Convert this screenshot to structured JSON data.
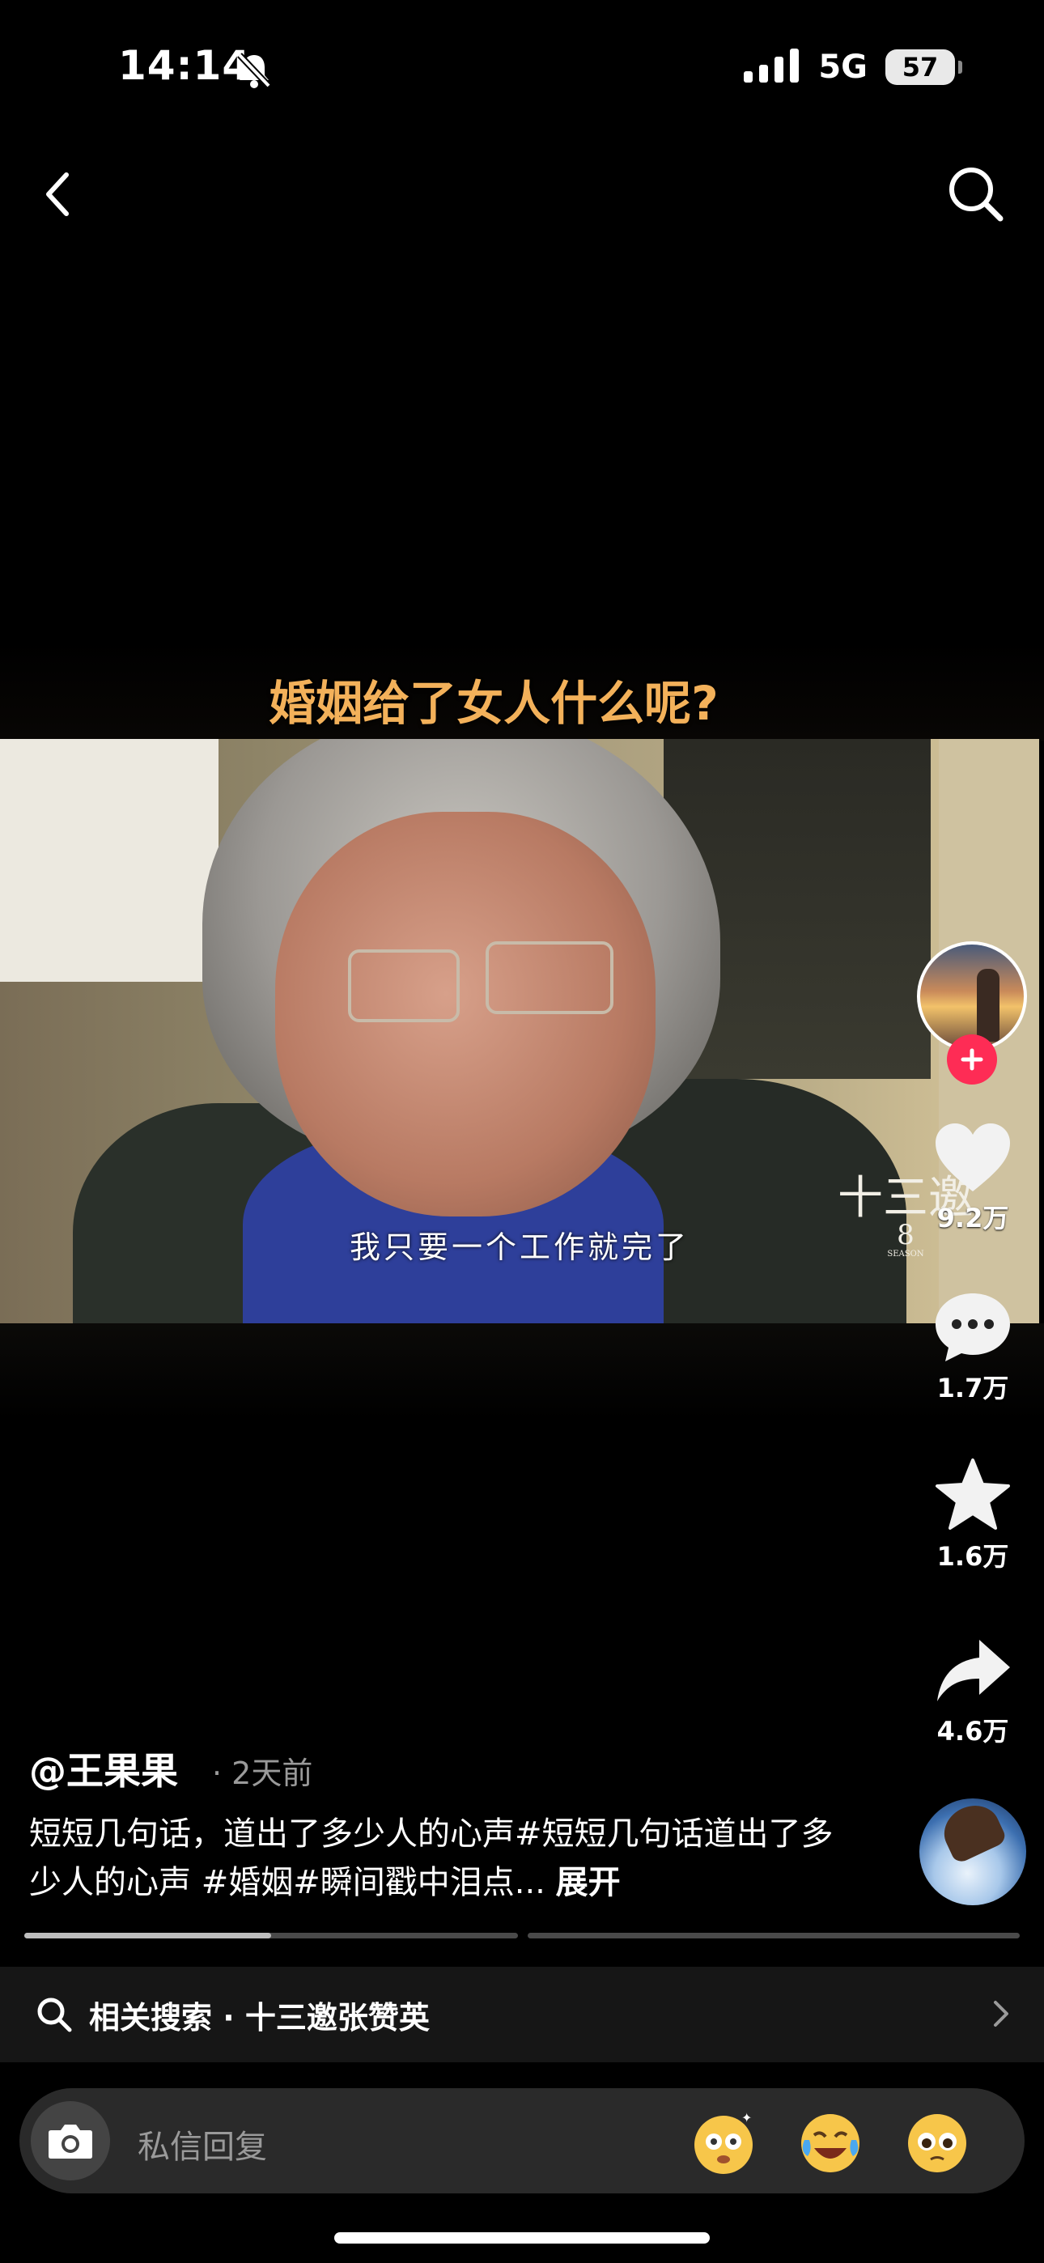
{
  "status_bar": {
    "time": "14:14",
    "network": "5G",
    "battery": "57",
    "icons": [
      "bell-slash-icon",
      "signal-icon"
    ]
  },
  "nav": {
    "back_icon": "chevron-left-icon",
    "search_icon": "search-icon"
  },
  "video": {
    "headline": "婚姻给了女人什么呢?",
    "subtitle": "我只要一个工作就完了",
    "watermark": "十三邀",
    "watermark_season": "8",
    "watermark_season_label": "SEASON"
  },
  "actions": {
    "like_count": "9.2万",
    "comment_count": "1.7万",
    "favorite_count": "1.6万",
    "share_count": "4.6万"
  },
  "post": {
    "author": "@王果果",
    "time_ago": "· 2天前",
    "description": "短短几句话，道出了多少人的心声#短短几句话道出了多少人的心声 #婚姻#瞬间戳中泪点...",
    "expand_label": "展开"
  },
  "progress": {
    "current_segment_fraction": 0.5,
    "segments": 2
  },
  "related_search": {
    "label": "相关搜索 · 十三邀张赞英"
  },
  "reply_bar": {
    "placeholder": "私信回复"
  },
  "colors": {
    "accent": "#fe2c55",
    "headline": "#f3b15a",
    "background": "#000000"
  }
}
